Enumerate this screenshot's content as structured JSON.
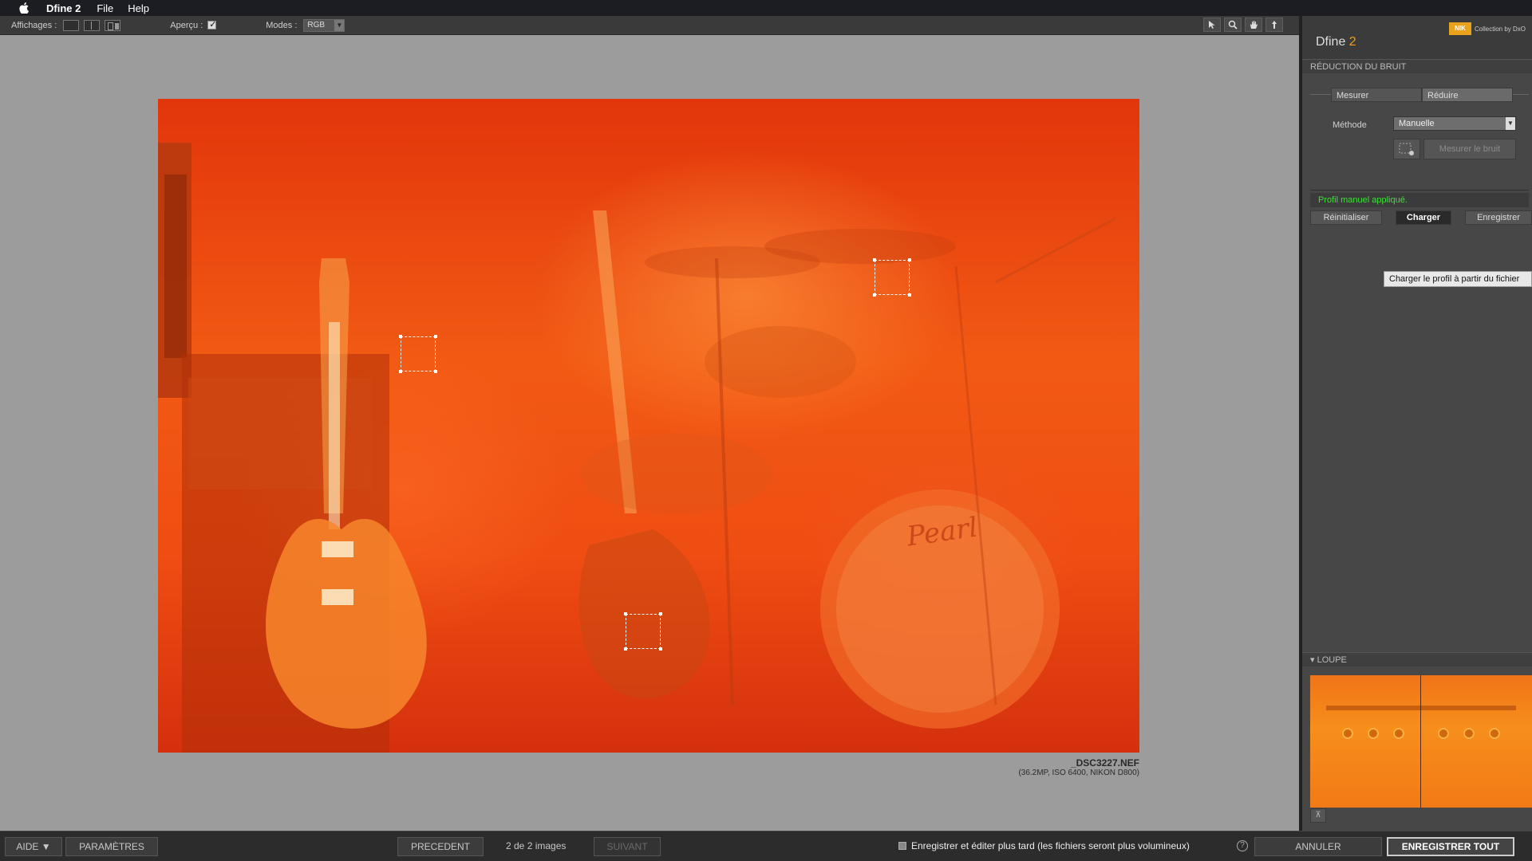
{
  "menubar": {
    "app": "Dfine 2",
    "items": [
      "File",
      "Help"
    ]
  },
  "toolbar": {
    "views_label": "Affichages :",
    "preview_label": "Aperçu :",
    "modes_label": "Modes :",
    "mode_value": "RGB"
  },
  "image": {
    "filename": "_DSC3227.NEF",
    "meta": "(36.2MP, ISO 6400, NIKON D800)"
  },
  "panel": {
    "brand": "Collection by DxO",
    "brand_logo": "NIK",
    "title_main": "Dfine ",
    "title_num": "2",
    "section": "RÉDUCTION DU BRUIT",
    "tabs": [
      "Mesurer",
      "Réduire"
    ],
    "method_label": "Méthode",
    "method_value": "Manuelle",
    "measure_button": "Mesurer le bruit",
    "status": "Profil manuel appliqué.",
    "buttons": {
      "reset": "Réinitialiser",
      "load": "Charger",
      "save": "Enregistrer"
    },
    "tooltip": "Charger le profil à partir du fichier",
    "loupe_label": "LOUPE"
  },
  "bottom": {
    "help": "AIDE ▼",
    "settings": "PARAMÈTRES",
    "prev": "PRECEDENT",
    "counter": "2 de 2 images",
    "next": "SUIVANT",
    "save_later": "Enregistrer et éditer plus tard (les fichiers seront plus volumineux)",
    "help_icon": "?",
    "cancel": "ANNULER",
    "save_all": "ENREGISTRER TOUT"
  }
}
